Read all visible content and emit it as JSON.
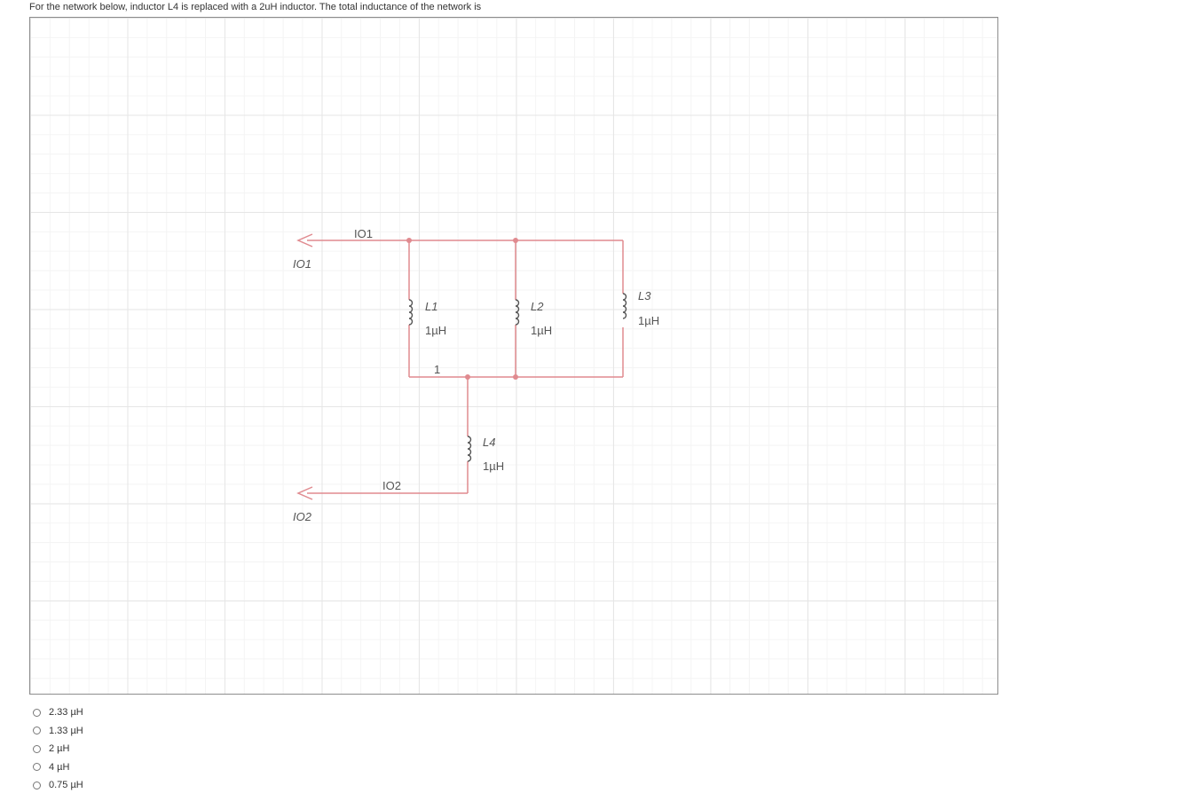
{
  "question": {
    "text": "For the network below, inductor L4 is replaced with a 2uH inductor. The total inductance of the network is"
  },
  "diagram": {
    "ports": [
      {
        "id": "IO1",
        "wire_label": "IO1",
        "port_label": "IO1"
      },
      {
        "id": "IO2",
        "wire_label": "IO2",
        "port_label": "IO2"
      }
    ],
    "inductors": [
      {
        "name": "L1",
        "value": "1µH"
      },
      {
        "name": "L2",
        "value": "1µH"
      },
      {
        "name": "L3",
        "value": "1µH"
      },
      {
        "name": "L4",
        "value": "1µH"
      }
    ],
    "node_label": "1",
    "colors": {
      "wire": "#e08a8f",
      "component": "#555555",
      "grid": "#e6e6e6"
    }
  },
  "options": [
    {
      "label": "2.33 µH"
    },
    {
      "label": "1.33 µH"
    },
    {
      "label": "2 µH"
    },
    {
      "label": "4 µH"
    },
    {
      "label": "0.75 µH"
    }
  ]
}
